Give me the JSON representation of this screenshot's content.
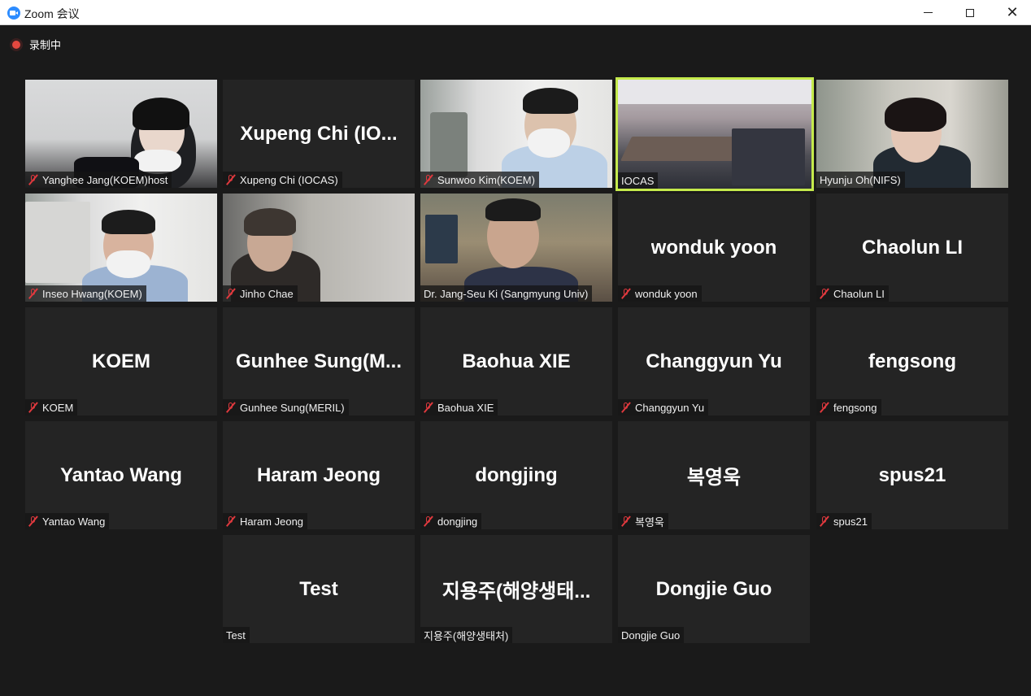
{
  "window": {
    "title": "Zoom 会议"
  },
  "recording": {
    "label": "录制中"
  },
  "colors": {
    "active_border": "#c5ea4c",
    "muted": "#e0393e",
    "tile_bg": "#242424",
    "recording": "#e5483f"
  },
  "participants": [
    {
      "label": "Yanghee Jang(KOEM)host",
      "muted": true
    },
    {
      "display": "Xupeng Chi (IO...",
      "label": "Xupeng Chi (IOCAS)",
      "muted": true
    },
    {
      "label": "Sunwoo Kim(KOEM)",
      "muted": true
    },
    {
      "label": "IOCAS",
      "muted": false
    },
    {
      "label": "Hyunju Oh(NIFS)",
      "muted": false
    },
    {
      "label": "Inseo Hwang(KOEM)",
      "muted": true
    },
    {
      "label": "Jinho Chae",
      "muted": true
    },
    {
      "label": "Dr. Jang-Seu Ki (Sangmyung Univ)",
      "muted": false
    },
    {
      "display": "wonduk yoon",
      "label": "wonduk yoon",
      "muted": true
    },
    {
      "display": "Chaolun LI",
      "label": "Chaolun LI",
      "muted": true
    },
    {
      "display": "KOEM",
      "label": "KOEM",
      "muted": true
    },
    {
      "display": "Gunhee  Sung(M...",
      "label": "Gunhee Sung(MERIL)",
      "muted": true
    },
    {
      "display": "Baohua XIE",
      "label": "Baohua XIE",
      "muted": true
    },
    {
      "display": "Changgyun Yu",
      "label": "Changgyun Yu",
      "muted": true
    },
    {
      "display": "fengsong",
      "label": "fengsong",
      "muted": true
    },
    {
      "display": "Yantao Wang",
      "label": "Yantao Wang",
      "muted": true
    },
    {
      "display": "Haram Jeong",
      "label": "Haram Jeong",
      "muted": true
    },
    {
      "display": "dongjing",
      "label": "dongjing",
      "muted": true
    },
    {
      "display": "복영욱",
      "label": "복영욱",
      "muted": true
    },
    {
      "display": "spus21",
      "label": "spus21",
      "muted": true
    },
    {
      "display": "Test",
      "label": "Test",
      "muted": false
    },
    {
      "display": "지용주(해양생태...",
      "label": "지용주(해양생태처)",
      "muted": false
    },
    {
      "display": "Dongjie Guo",
      "label": "Dongjie Guo",
      "muted": false
    }
  ]
}
